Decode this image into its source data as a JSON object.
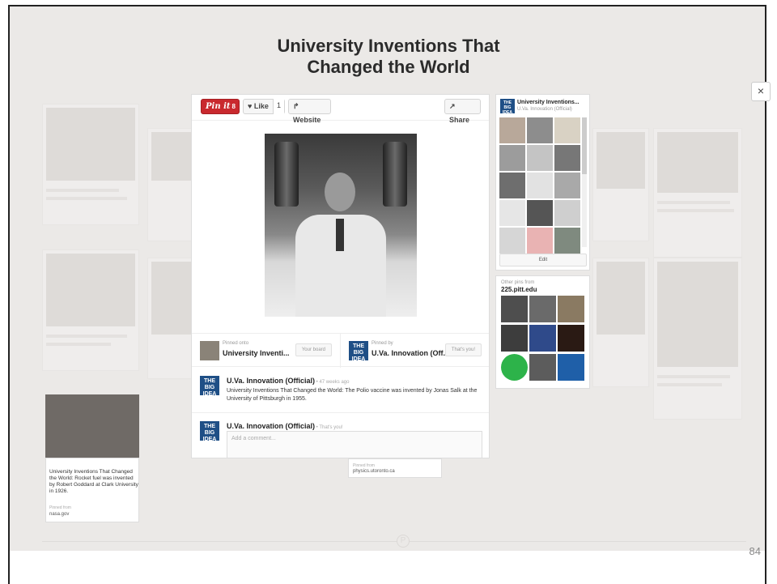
{
  "slide": {
    "title": "University Inventions That\nChanged the World",
    "page_number": "84"
  },
  "toolbar": {
    "pinit_label": "Pin it",
    "pinit_count": "8",
    "like_label": "♥ Like",
    "like_count": "1",
    "website_label": "↱ Website",
    "share_label": "↗ Share"
  },
  "pinned_onto": {
    "label": "Pinned onto",
    "board": "University Inventi...",
    "button": "Your board"
  },
  "pinned_by": {
    "label": "Pinned by",
    "user": "U.Va. Innovation (Off...",
    "button": "That's you!"
  },
  "comments": [
    {
      "author": "U.Va. Innovation (Official)",
      "meta": " • 47 weeks ago",
      "text": "University Inventions That Changed the World: The Polio vaccine was invented by Jonas Salk at the University of Pittsburgh in 1955."
    },
    {
      "author": "U.Va. Innovation (Official)",
      "meta": " • That's you!",
      "placeholder": "Add a comment..."
    }
  ],
  "board": {
    "title": "University Inventions...",
    "owner": "U.Va. Innovation (Official)",
    "edit_label": "Edit"
  },
  "other_pins": {
    "label": "Other pins from",
    "source": "225.pitt.edu"
  },
  "rocket_card": {
    "text": "University Inventions That Changed the World: Rocket fuel was invented by Robert Goddard at Clark University in 1926.",
    "pinned_from": "Pinned from",
    "source": "nasa.gov"
  },
  "physics_card": {
    "pinned_from": "Pinned from",
    "source": "physics.utoronto.ca"
  },
  "icons": {
    "close": "close-icon",
    "big_idea": "big-idea-logo",
    "pinterest": "pinterest-logo"
  },
  "colors": {
    "pinit_red": "#c9292e",
    "big_idea_blue": "#1f4f86",
    "backdrop": "#ebe9e7"
  },
  "close_label": "×",
  "big_idea_text": "THE BIG IDEA"
}
